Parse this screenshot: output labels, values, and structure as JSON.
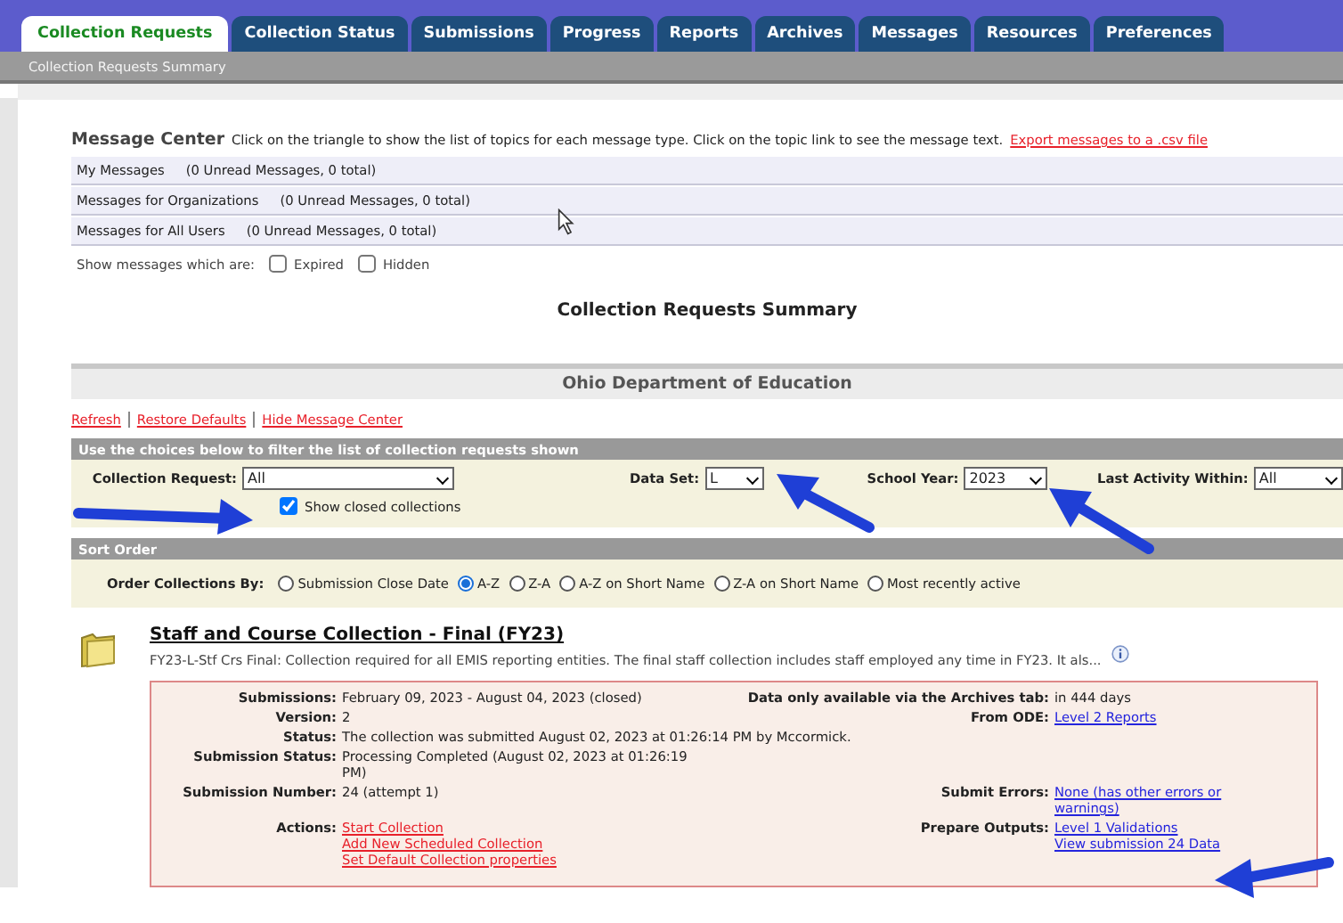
{
  "tabs": [
    {
      "label": "Collection Requests",
      "selected": true
    },
    {
      "label": "Collection Status",
      "selected": false
    },
    {
      "label": "Submissions",
      "selected": false
    },
    {
      "label": "Progress",
      "selected": false
    },
    {
      "label": "Reports",
      "selected": false
    },
    {
      "label": "Archives",
      "selected": false
    },
    {
      "label": "Messages",
      "selected": false
    },
    {
      "label": "Resources",
      "selected": false
    },
    {
      "label": "Preferences",
      "selected": false
    }
  ],
  "breadcrumb": "Collection Requests Summary",
  "message_center": {
    "title": "Message Center",
    "instructions": "Click on the triangle to show the list of topics for each message type. Click on the topic link to see the message text.",
    "export_link": "Export messages to a .csv file",
    "rows": [
      {
        "name": "My Messages",
        "counts": "(0 Unread Messages, 0 total)"
      },
      {
        "name": "Messages for Organizations",
        "counts": "(0 Unread Messages, 0 total)"
      },
      {
        "name": "Messages for All Users",
        "counts": "(0 Unread Messages, 0 total)"
      }
    ],
    "show_label": "Show messages which are:",
    "filters": [
      {
        "label": "Expired",
        "checked": false
      },
      {
        "label": "Hidden",
        "checked": false
      }
    ]
  },
  "page_title": "Collection Requests Summary",
  "organization": "Ohio Department of Education",
  "links": [
    "Refresh",
    "Restore Defaults",
    "Hide Message Center"
  ],
  "filter": {
    "header": "Use the choices below to filter the list of collection requests shown",
    "collection_request": {
      "label": "Collection Request:",
      "value": "All"
    },
    "data_set": {
      "label": "Data Set:",
      "value": "L"
    },
    "school_year": {
      "label": "School Year:",
      "value": "2023"
    },
    "last_activity": {
      "label": "Last Activity Within:",
      "value": "All"
    },
    "show_closed": {
      "label": "Show closed collections",
      "checked": true
    }
  },
  "sort": {
    "header": "Sort Order",
    "label": "Order Collections By:",
    "options": [
      {
        "label": "Submission Close Date",
        "selected": false
      },
      {
        "label": "A-Z",
        "selected": true
      },
      {
        "label": "Z-A",
        "selected": false
      },
      {
        "label": "A-Z on Short Name",
        "selected": false
      },
      {
        "label": "Z-A on Short Name",
        "selected": false
      },
      {
        "label": "Most recently active",
        "selected": false
      }
    ]
  },
  "collection": {
    "title": "Staff and Course Collection - Final (FY23)",
    "description": "FY23-L-Stf Crs Final: Collection required for all EMIS reporting entities. The final staff collection includes staff employed any time in FY23. It als...",
    "rows": [
      {
        "label": "Submissions:",
        "values": [
          {
            "text": "February 09, 2023 - August 04, 2023 (closed)",
            "kind": "text"
          }
        ],
        "right_label": "Data only available via the Archives tab:",
        "right_values": [
          {
            "text": "in 444 days",
            "kind": "text"
          }
        ]
      },
      {
        "label": "Version:",
        "values": [
          {
            "text": "2",
            "kind": "text"
          }
        ],
        "right_label": "From ODE:",
        "right_values": [
          {
            "text": "Level 2 Reports",
            "kind": "link"
          }
        ]
      },
      {
        "label": "Status:",
        "wide": true,
        "values": [
          {
            "text": "The collection was submitted August 02, 2023 at 01:26:14 PM by Mccormick.",
            "kind": "text"
          }
        ]
      },
      {
        "label": "Submission Status:",
        "values": [
          {
            "text": "Processing Completed (August 02, 2023 at 01:26:19 PM)",
            "kind": "text"
          }
        ]
      },
      {
        "label": "Submission Number:",
        "values": [
          {
            "text": "24 (attempt 1)",
            "kind": "text"
          }
        ],
        "right_label": "Submit Errors:",
        "right_values": [
          {
            "text": "None (has other errors or warnings)",
            "kind": "link"
          }
        ]
      },
      {
        "label": "Actions:",
        "values": [
          {
            "text": "Start Collection",
            "kind": "action"
          },
          {
            "text": "Add New Scheduled Collection",
            "kind": "action"
          },
          {
            "text": "Set Default Collection properties",
            "kind": "action"
          }
        ],
        "right_label": "Prepare Outputs:",
        "right_values": [
          {
            "text": "Level 1 Validations",
            "kind": "link"
          },
          {
            "text": "View submission 24 Data",
            "kind": "link"
          }
        ]
      }
    ]
  }
}
